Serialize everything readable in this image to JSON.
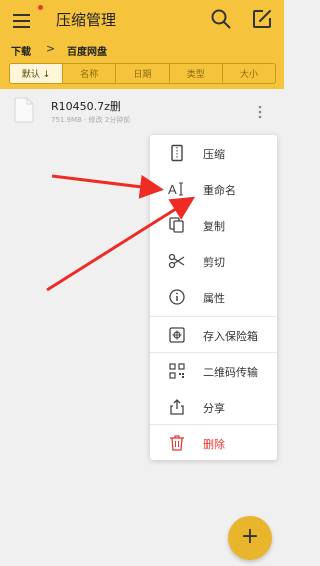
{
  "app": {
    "title": "压缩管理"
  },
  "icons": {
    "menu": "hamburger-menu-icon",
    "search": "search-icon",
    "edit": "edit-icon",
    "file": "file-icon",
    "more": "more-vertical-icon",
    "fab": "plus-icon"
  },
  "breadcrumb": {
    "items": [
      "下载",
      "百度网盘"
    ],
    "separator": ">"
  },
  "sort": {
    "tabs": [
      "默认 ↓",
      "名称",
      "日期",
      "类型",
      "大小"
    ],
    "active_index": 0
  },
  "files": [
    {
      "name": "R10450.7z删",
      "meta": "751.9MB · 修改 2分钟前"
    }
  ],
  "context_menu": {
    "items": [
      {
        "label": "压缩",
        "icon": "compress-icon"
      },
      {
        "label": "重命名",
        "icon": "rename-icon"
      },
      {
        "label": "复制",
        "icon": "copy-icon"
      },
      {
        "label": "剪切",
        "icon": "scissors-icon"
      },
      {
        "label": "属性",
        "icon": "info-icon"
      },
      {
        "label": "存入保险箱",
        "icon": "safe-icon"
      },
      {
        "label": "二维码传输",
        "icon": "qrcode-icon"
      },
      {
        "label": "分享",
        "icon": "share-icon"
      },
      {
        "label": "删除",
        "icon": "trash-icon"
      }
    ]
  },
  "fab": {
    "label": "+"
  },
  "colors": {
    "accent": "#f6c43c",
    "fab": "#e8b52d",
    "danger": "#e53935",
    "arrow": "#ee2b24"
  }
}
